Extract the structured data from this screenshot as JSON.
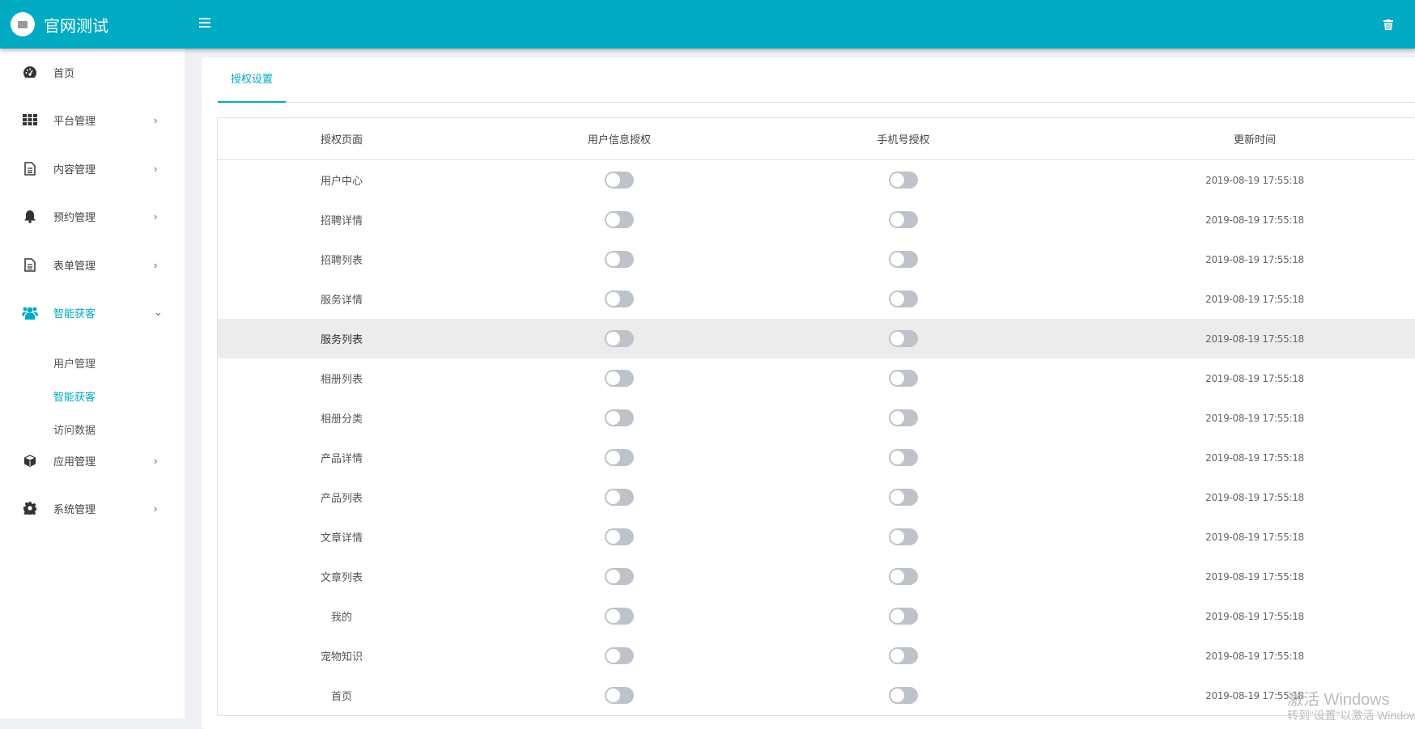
{
  "header": {
    "title": "官网测试"
  },
  "sidebar": {
    "items": [
      {
        "label": "首页",
        "icon": "dashboard-icon"
      },
      {
        "label": "平台管理",
        "icon": "grid-icon"
      },
      {
        "label": "内容管理",
        "icon": "document-icon"
      },
      {
        "label": "预约管理",
        "icon": "bell-icon"
      },
      {
        "label": "表单管理",
        "icon": "form-icon"
      },
      {
        "label": "智能获客",
        "icon": "users-icon"
      },
      {
        "label": "应用管理",
        "icon": "cube-icon"
      },
      {
        "label": "系统管理",
        "icon": "gear-icon"
      }
    ],
    "subitems": [
      "用户管理",
      "智能获客",
      "访问数据"
    ]
  },
  "tabs": [
    "授权设置"
  ],
  "table": {
    "columns": [
      "授权页面",
      "用户信息授权",
      "手机号授权",
      "更新时间"
    ],
    "rows": [
      {
        "page": "用户中心",
        "userinfo": false,
        "phone": false,
        "time": "2019-08-19 17:55:18"
      },
      {
        "page": "招聘详情",
        "userinfo": false,
        "phone": false,
        "time": "2019-08-19 17:55:18"
      },
      {
        "page": "招聘列表",
        "userinfo": false,
        "phone": false,
        "time": "2019-08-19 17:55:18"
      },
      {
        "page": "服务详情",
        "userinfo": false,
        "phone": false,
        "time": "2019-08-19 17:55:18"
      },
      {
        "page": "服务列表",
        "userinfo": false,
        "phone": false,
        "time": "2019-08-19 17:55:18"
      },
      {
        "page": "相册列表",
        "userinfo": false,
        "phone": false,
        "time": "2019-08-19 17:55:18"
      },
      {
        "page": "相册分类",
        "userinfo": false,
        "phone": false,
        "time": "2019-08-19 17:55:18"
      },
      {
        "page": "产品详情",
        "userinfo": false,
        "phone": false,
        "time": "2019-08-19 17:55:18"
      },
      {
        "page": "产品列表",
        "userinfo": false,
        "phone": false,
        "time": "2019-08-19 17:55:18"
      },
      {
        "page": "文章详情",
        "userinfo": false,
        "phone": false,
        "time": "2019-08-19 17:55:18"
      },
      {
        "page": "文章列表",
        "userinfo": false,
        "phone": false,
        "time": "2019-08-19 17:55:18"
      },
      {
        "page": "我的",
        "userinfo": false,
        "phone": false,
        "time": "2019-08-19 17:55:18"
      },
      {
        "page": "宠物知识",
        "userinfo": false,
        "phone": false,
        "time": "2019-08-19 17:55:18"
      },
      {
        "page": "首页",
        "userinfo": false,
        "phone": false,
        "time": "2019-08-19 17:55:18"
      }
    ]
  },
  "watermark": {
    "line1": "激活 Windows",
    "line2": "转到“设置”以激活 Windows。"
  },
  "colors": {
    "accent": "#00abc3",
    "toggle_off": "#bec3ca",
    "row_hover": "#ececec"
  }
}
